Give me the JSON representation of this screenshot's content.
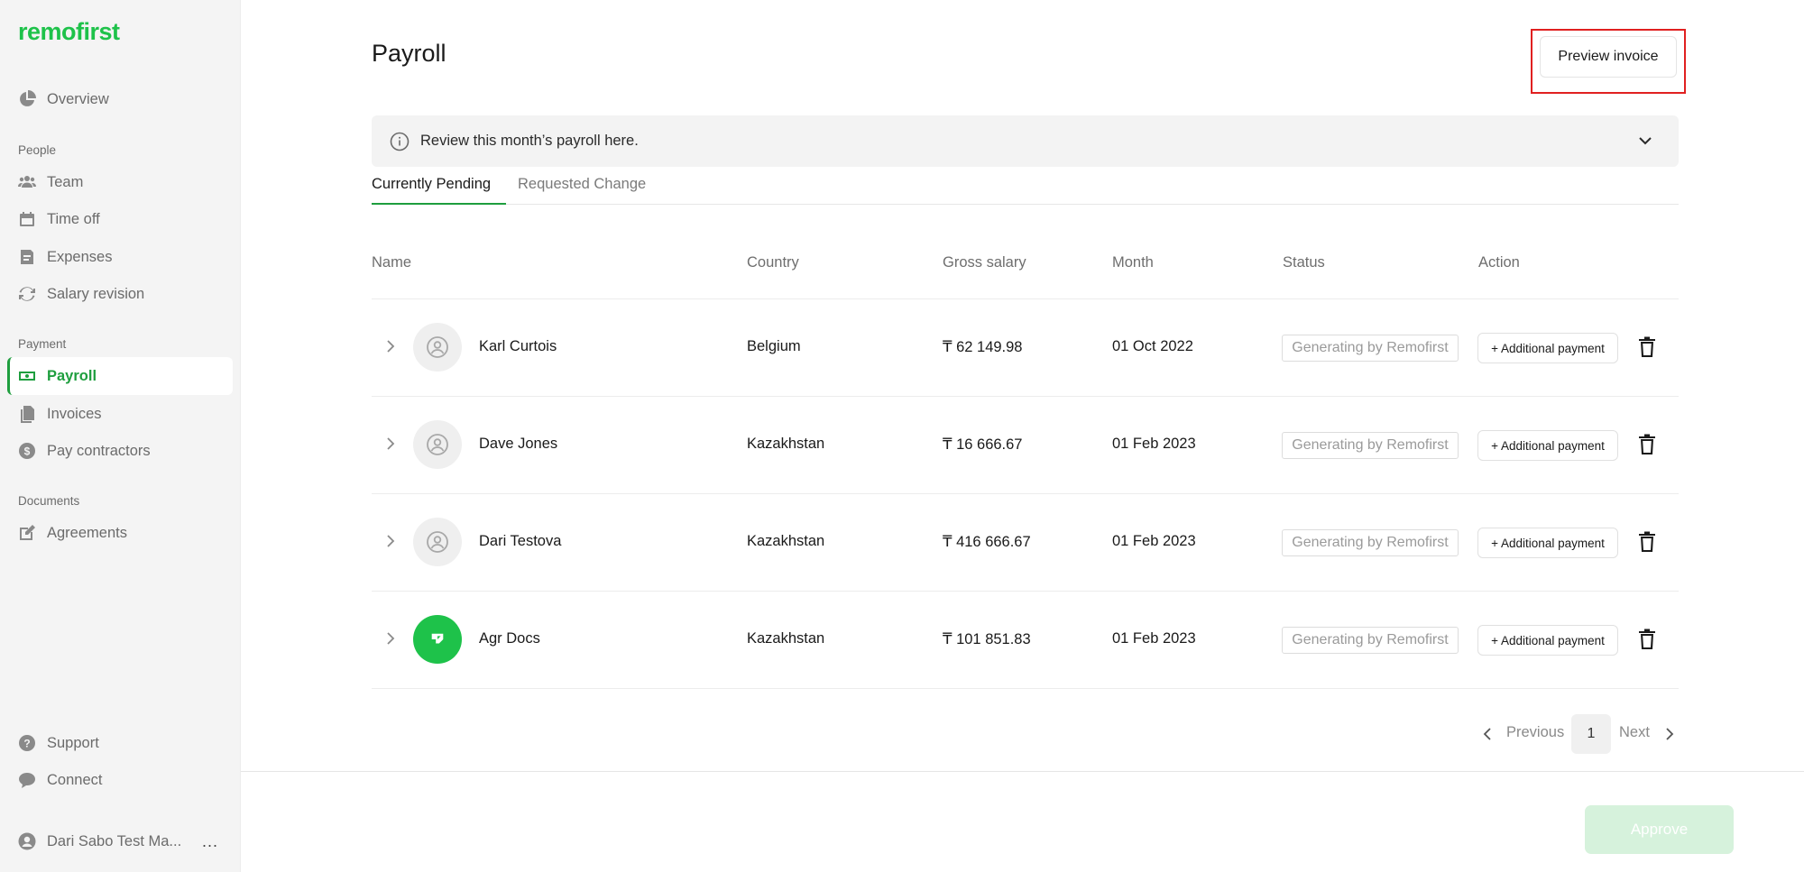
{
  "app": {
    "logo": "remofirst",
    "brand_color": "#1ec24a"
  },
  "sidebar": {
    "top_items": [
      {
        "label": "Overview",
        "icon": "pie-chart-icon"
      }
    ],
    "sections": [
      {
        "label": "People",
        "items": [
          {
            "label": "Team",
            "icon": "team-icon"
          },
          {
            "label": "Time off",
            "icon": "calendar-icon"
          },
          {
            "label": "Expenses",
            "icon": "expenses-icon"
          },
          {
            "label": "Salary revision",
            "icon": "refresh-icon"
          }
        ]
      },
      {
        "label": "Payment",
        "items": [
          {
            "label": "Payroll",
            "icon": "cash-icon",
            "active": true
          },
          {
            "label": "Invoices",
            "icon": "documents-icon"
          },
          {
            "label": "Pay contractors",
            "icon": "dollar-icon"
          }
        ]
      },
      {
        "label": "Documents",
        "items": [
          {
            "label": "Agreements",
            "icon": "edit-icon"
          }
        ]
      }
    ],
    "bottom_items": [
      {
        "label": "Support",
        "icon": "help-icon"
      },
      {
        "label": "Connect",
        "icon": "chat-icon"
      }
    ],
    "user": {
      "name": "Dari Sabo Test Ma...",
      "more": "..."
    }
  },
  "page": {
    "title": "Payroll",
    "preview_button": "Preview invoice",
    "info_text": "Review this month’s payroll here.",
    "tabs": [
      {
        "label": "Currently Pending",
        "active": true
      },
      {
        "label": "Requested Change",
        "active": false
      }
    ]
  },
  "table": {
    "columns": [
      "Name",
      "Country",
      "Gross salary",
      "Month",
      "Status",
      "Action"
    ],
    "rows": [
      {
        "name": "Karl Curtois",
        "country": "Belgium",
        "gross_salary": "₸ 62 149.98",
        "month": "01 Oct 2022",
        "status": "Generating by Remofirst",
        "action": "+ Additional payment",
        "avatar": "placeholder"
      },
      {
        "name": "Dave Jones",
        "country": "Kazakhstan",
        "gross_salary": "₸ 16 666.67",
        "month": "01 Feb 2023",
        "status": "Generating by Remofirst",
        "action": "+ Additional payment",
        "avatar": "placeholder"
      },
      {
        "name": "Dari Testova",
        "country": "Kazakhstan",
        "gross_salary": "₸ 416 666.67",
        "month": "01 Feb 2023",
        "status": "Generating by Remofirst",
        "action": "+ Additional payment",
        "avatar": "placeholder"
      },
      {
        "name": "Agr Docs",
        "country": "Kazakhstan",
        "gross_salary": "₸ 101 851.83",
        "month": "01 Feb 2023",
        "status": "Generating by Remofirst",
        "action": "+ Additional payment",
        "avatar": "logo"
      }
    ]
  },
  "pagination": {
    "previous": "Previous",
    "current_page": "1",
    "next": "Next"
  },
  "footer": {
    "approve_button": "Approve",
    "approve_enabled": false
  }
}
